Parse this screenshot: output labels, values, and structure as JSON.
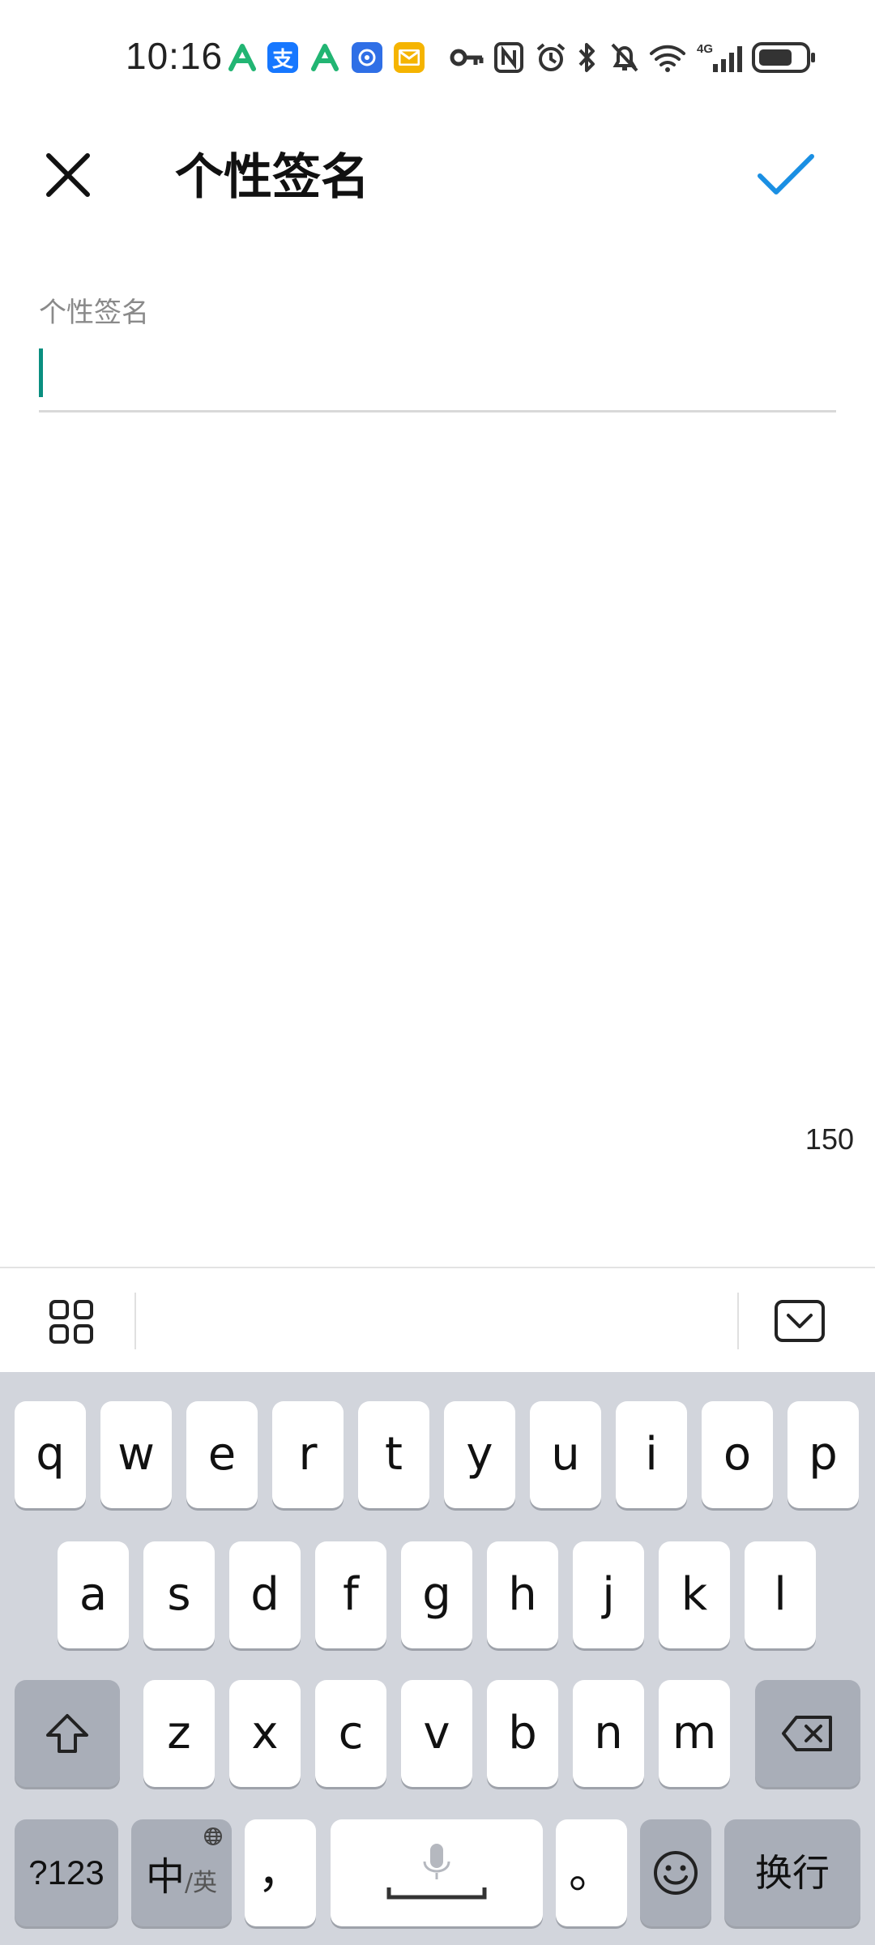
{
  "status_bar": {
    "time": "10:16",
    "apps": [
      {
        "icon": "app-green-a-icon",
        "color": "#22b573"
      },
      {
        "icon": "alipay-icon",
        "label": "支",
        "color": "#1677ff"
      },
      {
        "icon": "app-green-a-icon",
        "color": "#22b573"
      },
      {
        "icon": "app-blue-icon",
        "color": "#2f6fe6"
      },
      {
        "icon": "mail-icon",
        "color": "#f5b400"
      }
    ],
    "icons": [
      "key-icon",
      "nfc-icon",
      "alarm-icon",
      "bluetooth-icon",
      "mute-icon",
      "wifi-icon",
      "signal-4g-icon",
      "battery-icon"
    ],
    "network": "4G"
  },
  "header": {
    "close_icon": "close-icon",
    "title": "个性签名",
    "confirm_icon": "check-icon",
    "accent": "#1a8fe3"
  },
  "field": {
    "label": "个性签名",
    "value": "",
    "caret_color": "#0a8f80",
    "counter": "150"
  },
  "keyboard_toolbar": {
    "left_icon": "grid-apps-icon",
    "right_icon": "keyboard-hide-icon"
  },
  "keyboard": {
    "row1": [
      "q",
      "w",
      "e",
      "r",
      "t",
      "y",
      "u",
      "i",
      "o",
      "p"
    ],
    "row2": [
      "a",
      "s",
      "d",
      "f",
      "g",
      "h",
      "j",
      "k",
      "l"
    ],
    "row3": [
      "z",
      "x",
      "c",
      "v",
      "b",
      "n",
      "m"
    ],
    "shift_icon": "shift-icon",
    "backspace_icon": "backspace-icon",
    "numeric": "?123",
    "lang_main": "中",
    "lang_alt": "/英",
    "comma": "，",
    "space_icon": "microphone-icon",
    "period": "。",
    "emoji_icon": "emoji-icon",
    "enter": "换行"
  }
}
